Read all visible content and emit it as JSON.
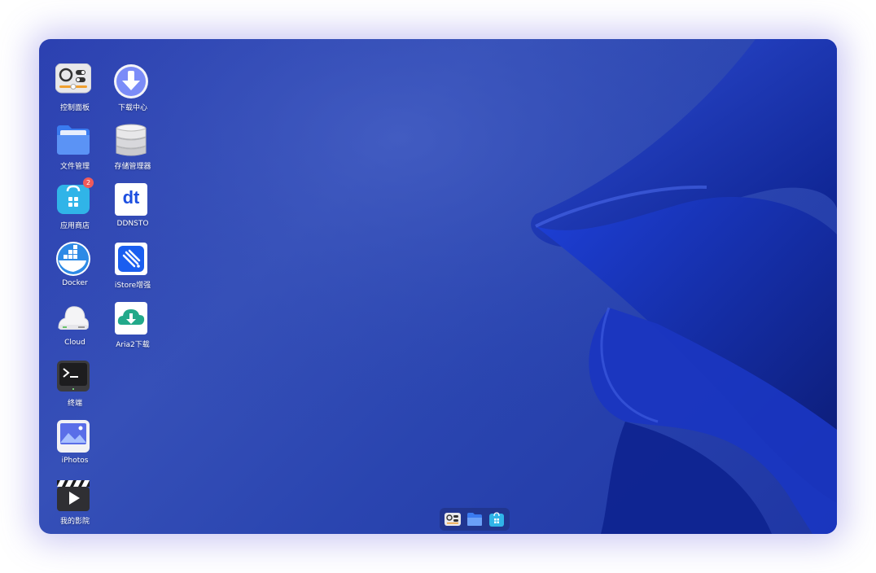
{
  "desktop": {
    "icons": [
      {
        "id": "control-panel",
        "label": "控制面板",
        "badge": ""
      },
      {
        "id": "download-center",
        "label": "下载中心",
        "badge": ""
      },
      {
        "id": "file-manager",
        "label": "文件管理",
        "badge": ""
      },
      {
        "id": "storage-manager",
        "label": "存储管理器",
        "badge": ""
      },
      {
        "id": "app-store",
        "label": "应用商店",
        "badge": "2"
      },
      {
        "id": "ddnsto",
        "label": "DDNSTO",
        "badge": ""
      },
      {
        "id": "docker",
        "label": "Docker",
        "badge": ""
      },
      {
        "id": "istore-enhance",
        "label": "iStore增强",
        "badge": ""
      },
      {
        "id": "cloud",
        "label": "Cloud",
        "badge": ""
      },
      {
        "id": "aria2",
        "label": "Aria2下载",
        "badge": ""
      },
      {
        "id": "terminal",
        "label": "终端",
        "badge": ""
      },
      {
        "id": "iphotos",
        "label": "iPhotos",
        "badge": ""
      },
      {
        "id": "my-cinema",
        "label": "我的影院",
        "badge": ""
      }
    ],
    "ddnsto_glyph": "dt"
  },
  "dock": {
    "items": [
      "control-panel-icon",
      "folder-icon",
      "app-store-icon"
    ]
  },
  "colors": {
    "wallpaper_base": "#2b3fb0",
    "accent": "#1d4fe0",
    "badge": "#f05a5a"
  }
}
